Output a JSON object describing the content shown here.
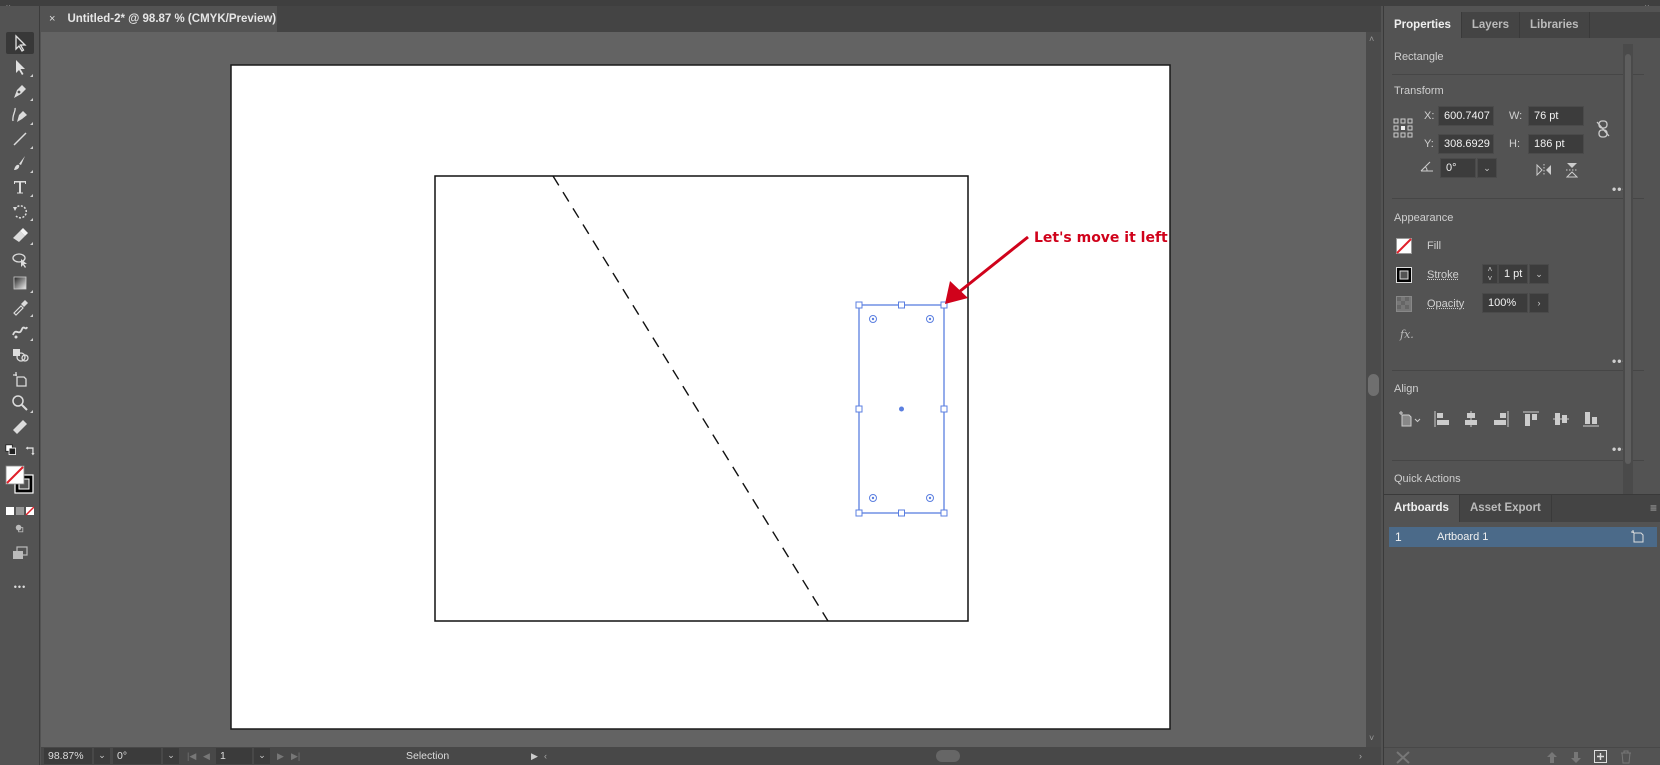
{
  "document_tab": {
    "close_glyph": "×",
    "title": "Untitled-2* @ 98.87 % (CMYK/Preview)"
  },
  "toolbar": {
    "tools": [
      {
        "name": "selection-tool",
        "active": true
      },
      {
        "name": "direct-selection-tool"
      },
      {
        "name": "pen-tool"
      },
      {
        "name": "curvature-tool"
      },
      {
        "name": "line-segment-tool"
      },
      {
        "name": "paintbrush-tool"
      },
      {
        "name": "type-tool"
      },
      {
        "name": "rotate-tool"
      },
      {
        "name": "eraser-tool"
      },
      {
        "name": "shape-builder-tool"
      },
      {
        "name": "gradient-tool"
      },
      {
        "name": "eyedropper-tool"
      },
      {
        "name": "blend-tool"
      },
      {
        "name": "symbol-sprayer-tool"
      },
      {
        "name": "artboard-tool"
      },
      {
        "name": "zoom-tool"
      },
      {
        "name": "measure-tool"
      }
    ],
    "more_glyph": "•••"
  },
  "canvas": {
    "annotation": {
      "text": "Let's move it left",
      "color": "#d0021b"
    },
    "selection_color": "#5b7fe0"
  },
  "statusbar": {
    "zoom": "98.87%",
    "rotation": "0°",
    "artboard_number": "1",
    "current_tool": "Selection"
  },
  "properties_panel": {
    "tabs": [
      "Properties",
      "Layers",
      "Libraries"
    ],
    "active_tab": "Properties",
    "object_type": "Rectangle",
    "transform": {
      "title": "Transform",
      "x_label": "X:",
      "x_value": "600.7407",
      "y_label": "Y:",
      "y_value": "308.6929",
      "w_label": "W:",
      "w_value": "76 pt",
      "h_label": "H:",
      "h_value": "186 pt",
      "angle_value": "0°"
    },
    "appearance": {
      "title": "Appearance",
      "fill_label": "Fill",
      "stroke_label": "Stroke",
      "stroke_value": "1 pt",
      "opacity_label": "Opacity",
      "opacity_value": "100%",
      "fx_label": "fx."
    },
    "align": {
      "title": "Align"
    },
    "quick_actions": {
      "title": "Quick Actions"
    }
  },
  "artboards_panel": {
    "tabs": [
      "Artboards",
      "Asset Export"
    ],
    "active_tab": "Artboards",
    "rows": [
      {
        "number": "1",
        "name": "Artboard 1",
        "selected": true
      }
    ]
  }
}
